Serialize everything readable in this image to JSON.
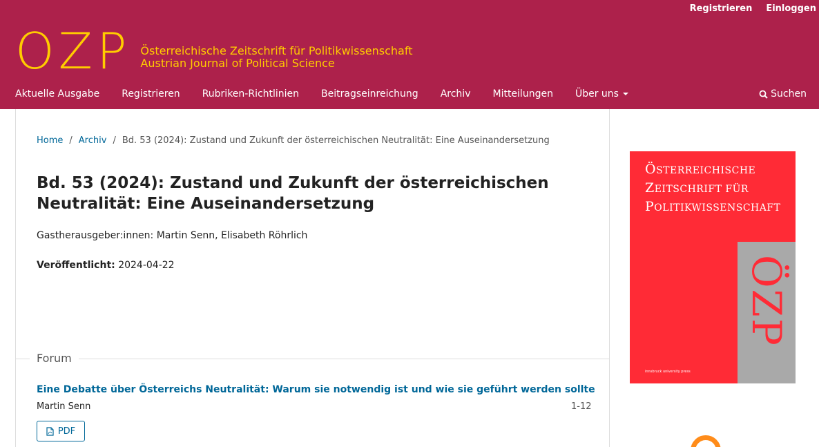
{
  "user_nav": {
    "register": "Registrieren",
    "login": "Einloggen"
  },
  "brand": {
    "logo": "OZP",
    "name_de": "Österreichische Zeitschrift für Politikwissenschaft",
    "name_en": "Austrian Journal of Political Science",
    "header_color": "#ad214b",
    "logo_color": "#ffcc00"
  },
  "nav": {
    "items": [
      "Aktuelle Ausgabe",
      "Registrieren",
      "Rubriken-Richtlinien",
      "Beitragseinreichung",
      "Archiv",
      "Mitteilungen",
      "Über uns"
    ],
    "search": "Suchen"
  },
  "breadcrumb": {
    "home": "Home",
    "archive": "Archiv",
    "current": "Bd. 53 (2024): Zustand und Zukunft der österreichischen Neutralität: Eine Auseinandersetzung"
  },
  "issue": {
    "title": "Bd. 53 (2024): Zustand und Zukunft der österreichischen Neutralität: Eine Auseinandersetzung",
    "editors": "Gastherausgeber:innen: Martin Senn, Elisabeth Röhrlich",
    "published_label": "Veröffentlicht:",
    "published_date": "2024-04-22"
  },
  "section": {
    "title": "Forum",
    "article": {
      "title": "Eine Debatte über Österreichs Neutralität: Warum sie notwendig ist und wie sie geführt werden sollte",
      "author": "Martin Senn",
      "pages": "1-12",
      "pdf_label": "PDF"
    }
  },
  "cover": {
    "line1_cap": "Ö",
    "line1_rest": "STERREICHISCHE",
    "line2_cap": "Z",
    "line2_rest": "EITSCHRIFT FÜR",
    "line3_cap": "P",
    "line3_rest": "OLITIKWISSENSCHAFT",
    "logo": "ÖZP",
    "publisher": "innsbruck university press",
    "color": "#ff2b36"
  }
}
